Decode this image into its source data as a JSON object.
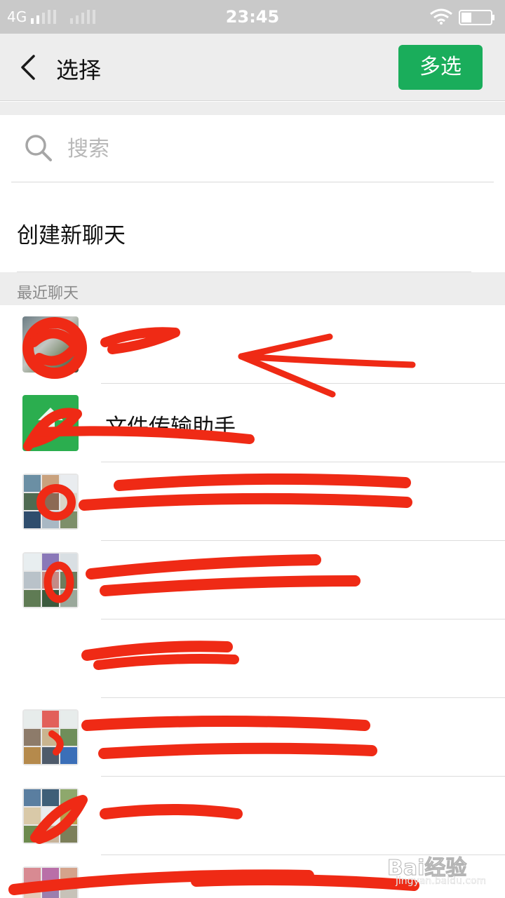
{
  "status_bar": {
    "network": "4G",
    "time": "23:45"
  },
  "header": {
    "title": "选择",
    "multi_select_label": "多选"
  },
  "search": {
    "placeholder": "搜索"
  },
  "create_chat_label": "创建新聊天",
  "recent_section_label": "最近聊天",
  "chats": [
    {
      "name": "",
      "avatar": "photo"
    },
    {
      "name": "文件传输助手",
      "avatar": "green"
    },
    {
      "name": "",
      "avatar": "group"
    },
    {
      "name": "",
      "avatar": "group"
    },
    {
      "name": "",
      "avatar": "none"
    },
    {
      "name": "",
      "avatar": "group"
    },
    {
      "name": "",
      "avatar": "group"
    },
    {
      "name": "",
      "avatar": "group"
    }
  ],
  "watermark": {
    "logo": "Bai经验",
    "url": "jingyan.baidu.com"
  },
  "colors": {
    "accent_green": "#1aad5b",
    "scribble_red": "#ef2a15"
  }
}
